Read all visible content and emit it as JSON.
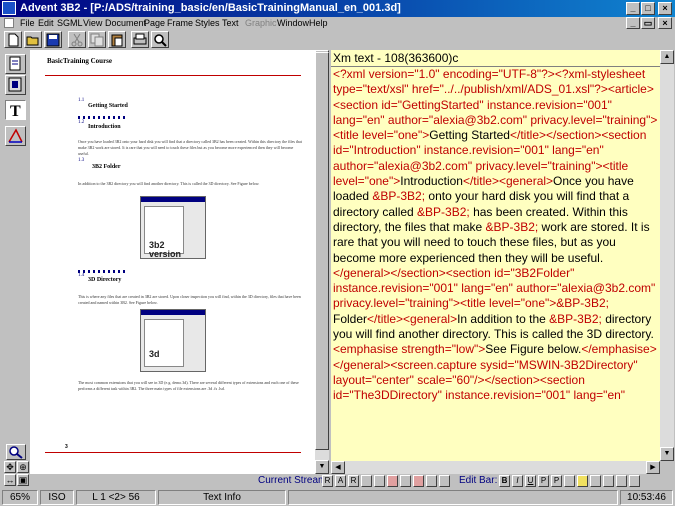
{
  "window": {
    "title": "Advent 3B2 - [P:/ADS/training_basic/en/BasicTrainingManual_en_001.3d]",
    "controls": [
      "minimize-icon",
      "maximize-icon",
      "close-icon"
    ]
  },
  "menu": {
    "items": [
      {
        "label": "File",
        "enabled": true
      },
      {
        "label": "Edit",
        "enabled": true
      },
      {
        "label": "SGML",
        "enabled": true
      },
      {
        "label": "View",
        "enabled": true
      },
      {
        "label": "Document",
        "enabled": true
      },
      {
        "label": "Page",
        "enabled": true
      },
      {
        "label": "Frame",
        "enabled": true
      },
      {
        "label": "Styles",
        "enabled": true
      },
      {
        "label": "Text",
        "enabled": true
      },
      {
        "label": "Graphic",
        "enabled": false
      },
      {
        "label": "Window",
        "enabled": true
      },
      {
        "label": "Help",
        "enabled": true
      }
    ]
  },
  "toolbar": {
    "buttons": [
      "new-document-icon",
      "open-folder-icon",
      "save-disk-icon",
      "cut-scissors-icon",
      "copy-icon",
      "paste-clipboard-icon",
      "print-icon",
      "find-magnifier-icon"
    ]
  },
  "palette": {
    "tools": [
      "page-tool-icon",
      "frame-tool-icon",
      "text-tool-icon",
      "graphic-line-tool-icon"
    ]
  },
  "document": {
    "header": "BasicTraining Course",
    "page_number": "3",
    "sections": [
      {
        "marker": "1.1",
        "heading": "Getting Started"
      },
      {
        "marker": "1.2",
        "heading": "Introduction",
        "body": "Once you have loaded 3B2 onto your hard disk you will find that a directory called 3B2 has been created. Within this directory the files that make 3B2 work are stored. It is rare that you will need to touch these files but as you become more experienced then they will become useful."
      },
      {
        "marker": "1.3",
        "heading": "3B2 Folder",
        "body": "In addition to the 3B2 directory you will find another directory. This is called the 3D directory. See Figure below.",
        "figure_label": "3b2 version"
      },
      {
        "marker": "1.4",
        "heading": "3D Directory",
        "body": "This is where any files that are created in 3B2 are stored. Upon closer inspection you will find, within the 3D directory, files that have been created and named within 3B2. See Figure below.",
        "figure_label": "3d"
      },
      {
        "marker": "",
        "heading": "",
        "body": "The most common extensions that you will see in 3D (e.g. demo.3d). There are several different types of extensions and each one of these performs a different task within 3B2. The three main types of file extensions are .3d .fs .lsd."
      }
    ]
  },
  "xml": {
    "header": "Xm text - 108(363600)c",
    "tokens": [
      {
        "k": "t",
        "v": "<?xml version=\"1.0\" encoding=\"UTF-8\"?><?xml-stylesheet type=\"text/xsl\" href=\"../../publish/xml/ADS_01.xsl\"?><article><section id=\"GettingStarted\" instance.revision=\"001\" lang=\"en\" author=\"alexia@3b2.com\" privacy.level=\"training\"><title level=\"one\">"
      },
      {
        "k": "c",
        "v": "Getting Started"
      },
      {
        "k": "t",
        "v": "</title></section><section id=\"Introduction\" instance.revision=\"001\" lang=\"en\" author=\"alexia@3b2.com\" privacy.level=\"training\"><title level=\"one\">"
      },
      {
        "k": "c",
        "v": "Introduction"
      },
      {
        "k": "t",
        "v": "</title><general>"
      },
      {
        "k": "c",
        "v": "Once you have loaded "
      },
      {
        "k": "t",
        "v": "&BP-3B2;"
      },
      {
        "k": "c",
        "v": " onto your hard disk you will find that a directory called "
      },
      {
        "k": "t",
        "v": "&BP-3B2;"
      },
      {
        "k": "c",
        "v": " has been created. Within this directory, the files that make "
      },
      {
        "k": "t",
        "v": "&BP-3B2;"
      },
      {
        "k": "c",
        "v": " work are stored. It is rare that you will need to touch these files, but as you become more experienced then they will be useful."
      },
      {
        "k": "t",
        "v": "</general></section><section id=\"3B2Folder\" instance.revision=\"001\" lang=\"en\" author=\"alexia@3b2.com\" privacy.level=\"training\"><title level=\"one\">"
      },
      {
        "k": "t",
        "v": "&BP-3B2;"
      },
      {
        "k": "c",
        "v": " Folder"
      },
      {
        "k": "t",
        "v": "</title><general>"
      },
      {
        "k": "c",
        "v": "In addition to the "
      },
      {
        "k": "t",
        "v": "&BP-3B2;"
      },
      {
        "k": "c",
        "v": " directory you will find another directory. This is called the 3D directory. "
      },
      {
        "k": "t",
        "v": "<emphasise strength=\"low\">"
      },
      {
        "k": "c",
        "v": "See Figure below."
      },
      {
        "k": "t",
        "v": "</emphasise></general><screen.capture sysid=\"MSWIN-3B2Directory\" layout=\"center\" scale=\"60\"/></section><section id=\"The3DDirectory\" instance.revision=\"001\" lang=\"en\""
      }
    ]
  },
  "streams": {
    "current_label": "Current Stream:",
    "current_buttons": [
      "R",
      "A",
      "R",
      "",
      "",
      "",
      "",
      "",
      "",
      ""
    ],
    "edit_label": "Edit Bar:",
    "edit_buttons": [
      "B",
      "I",
      "U",
      "P",
      "P",
      "",
      "",
      "",
      "",
      "",
      ""
    ]
  },
  "status": {
    "zoom": "65%",
    "format": "ISO",
    "position": "L 1 <2> 56",
    "mode": "Text Info",
    "time": "10:53:46"
  },
  "colors": {
    "titlebar": "#000080",
    "xml_background": "#ffffc0",
    "xml_tag": "#c00000",
    "stream_label": "#000080"
  }
}
